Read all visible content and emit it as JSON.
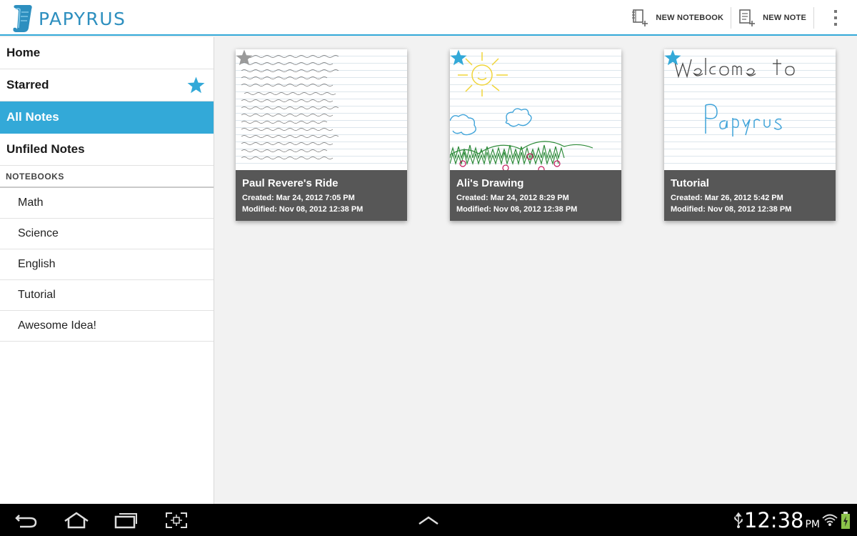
{
  "app": {
    "name": "PAPYRUS",
    "brand_color": "#33a9d8",
    "logo_icon": "scroll-logo-icon"
  },
  "actionbar": {
    "new_notebook": {
      "label": "NEW NOTEBOOK",
      "icon": "new-notebook-icon"
    },
    "new_note": {
      "label": "NEW NOTE",
      "icon": "new-note-icon"
    },
    "overflow_icon": "overflow-menu-icon"
  },
  "sidebar": {
    "items": [
      {
        "label": "Home"
      },
      {
        "label": "Starred",
        "icon": "star-icon"
      },
      {
        "label": "All Notes",
        "active": true
      },
      {
        "label": "Unfiled Notes"
      }
    ],
    "notebooks_header": "NOTEBOOKS",
    "notebooks": [
      {
        "label": "Math"
      },
      {
        "label": "Science"
      },
      {
        "label": "English"
      },
      {
        "label": "Tutorial"
      },
      {
        "label": "Awesome Idea!"
      }
    ]
  },
  "notes": [
    {
      "title": "Paul Revere's Ride",
      "created": "Created: Mar 24, 2012 7:05 PM",
      "modified": "Modified: Nov 08, 2012 12:38 PM",
      "starred": false
    },
    {
      "title": "Ali's Drawing",
      "created": "Created: Mar 24, 2012 8:29 PM",
      "modified": "Modified: Nov 08, 2012 12:38 PM",
      "starred": true
    },
    {
      "title": "Tutorial",
      "created": "Created: Mar 26, 2012 5:42 PM",
      "modified": "Modified: Nov 08, 2012 12:38 PM",
      "starred": true
    }
  ],
  "colors": {
    "star_active": "#33a9d8",
    "star_inactive": "#9a9a9a",
    "card_footer": "#575757"
  },
  "system_bar": {
    "time": "12:38",
    "ampm": "PM",
    "icons": [
      "back-icon",
      "home-icon",
      "recent-apps-icon",
      "screenshot-icon",
      "chevron-up-icon",
      "usb-icon",
      "wifi-icon",
      "battery-icon"
    ]
  }
}
